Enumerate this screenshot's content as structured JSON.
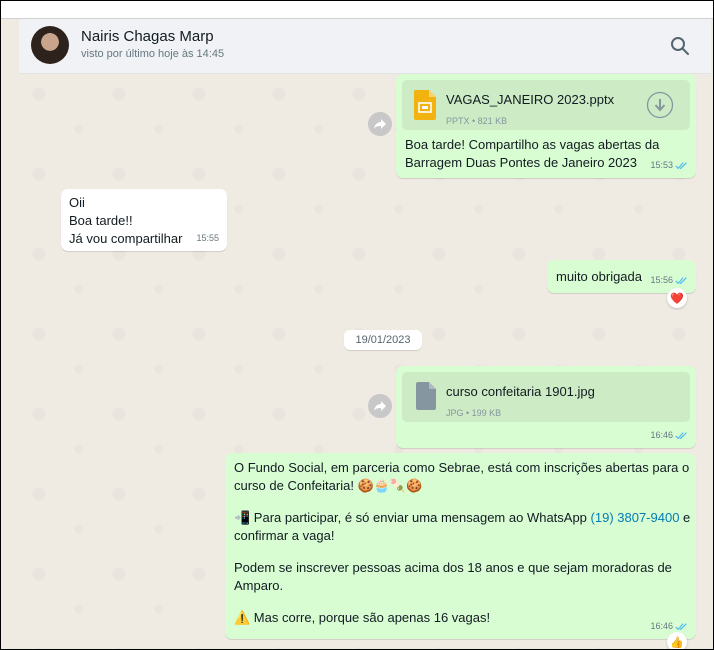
{
  "header": {
    "contact_name": "Nairis Chagas Marp",
    "last_seen": "visto por último hoje às 14:45"
  },
  "messages": [
    {
      "direction": "outgoing",
      "file": {
        "name": "VAGAS_JANEIRO 2023.pptx",
        "meta": "PPTX • 821 KB",
        "icon": "pptx-file-icon"
      },
      "text": "Boa tarde! Compartilho as vagas abertas da\nBarragem Duas Pontes de Janeiro 2023",
      "time": "15:53",
      "status": "read"
    },
    {
      "direction": "incoming",
      "text": "Oii\nBoa tarde!!\nJá vou compartilhar",
      "time": "15:55"
    },
    {
      "direction": "outgoing",
      "text": "muito obrigada",
      "time": "15:56",
      "status": "read",
      "reaction": "❤️"
    },
    {
      "direction": "outgoing",
      "file": {
        "name": "curso confeitaria 1901.jpg",
        "meta": "JPG • 199 KB",
        "icon": "generic-file-icon"
      },
      "time": "16:46",
      "status": "read"
    },
    {
      "direction": "outgoing",
      "para1": "O Fundo Social, em parceria como Sebrae, está com inscrições abertas para o\ncurso de Confeitaria! 🍪🧁🍡🍪",
      "para2_pre": "📲 Para participar, é só enviar uma mensagem ao WhatsApp ",
      "para2_link": "(19) 3807-9400",
      "para2_post": " e\nconfirmar a vaga!",
      "para3": "Podem se inscrever pessoas acima dos 18 anos e que sejam moradoras de\nAmparo.",
      "para4": "⚠️ Mas corre, porque são apenas 16 vagas!",
      "time": "16:46",
      "status": "read",
      "reaction": "👍"
    }
  ],
  "date_separator": "19/01/2023",
  "colors": {
    "outgoing_bubble": "#d9fdd3",
    "incoming_bubble": "#ffffff",
    "read_tick": "#53bdeb",
    "link": "#027eb5",
    "pptx_icon": "#f2b311"
  }
}
